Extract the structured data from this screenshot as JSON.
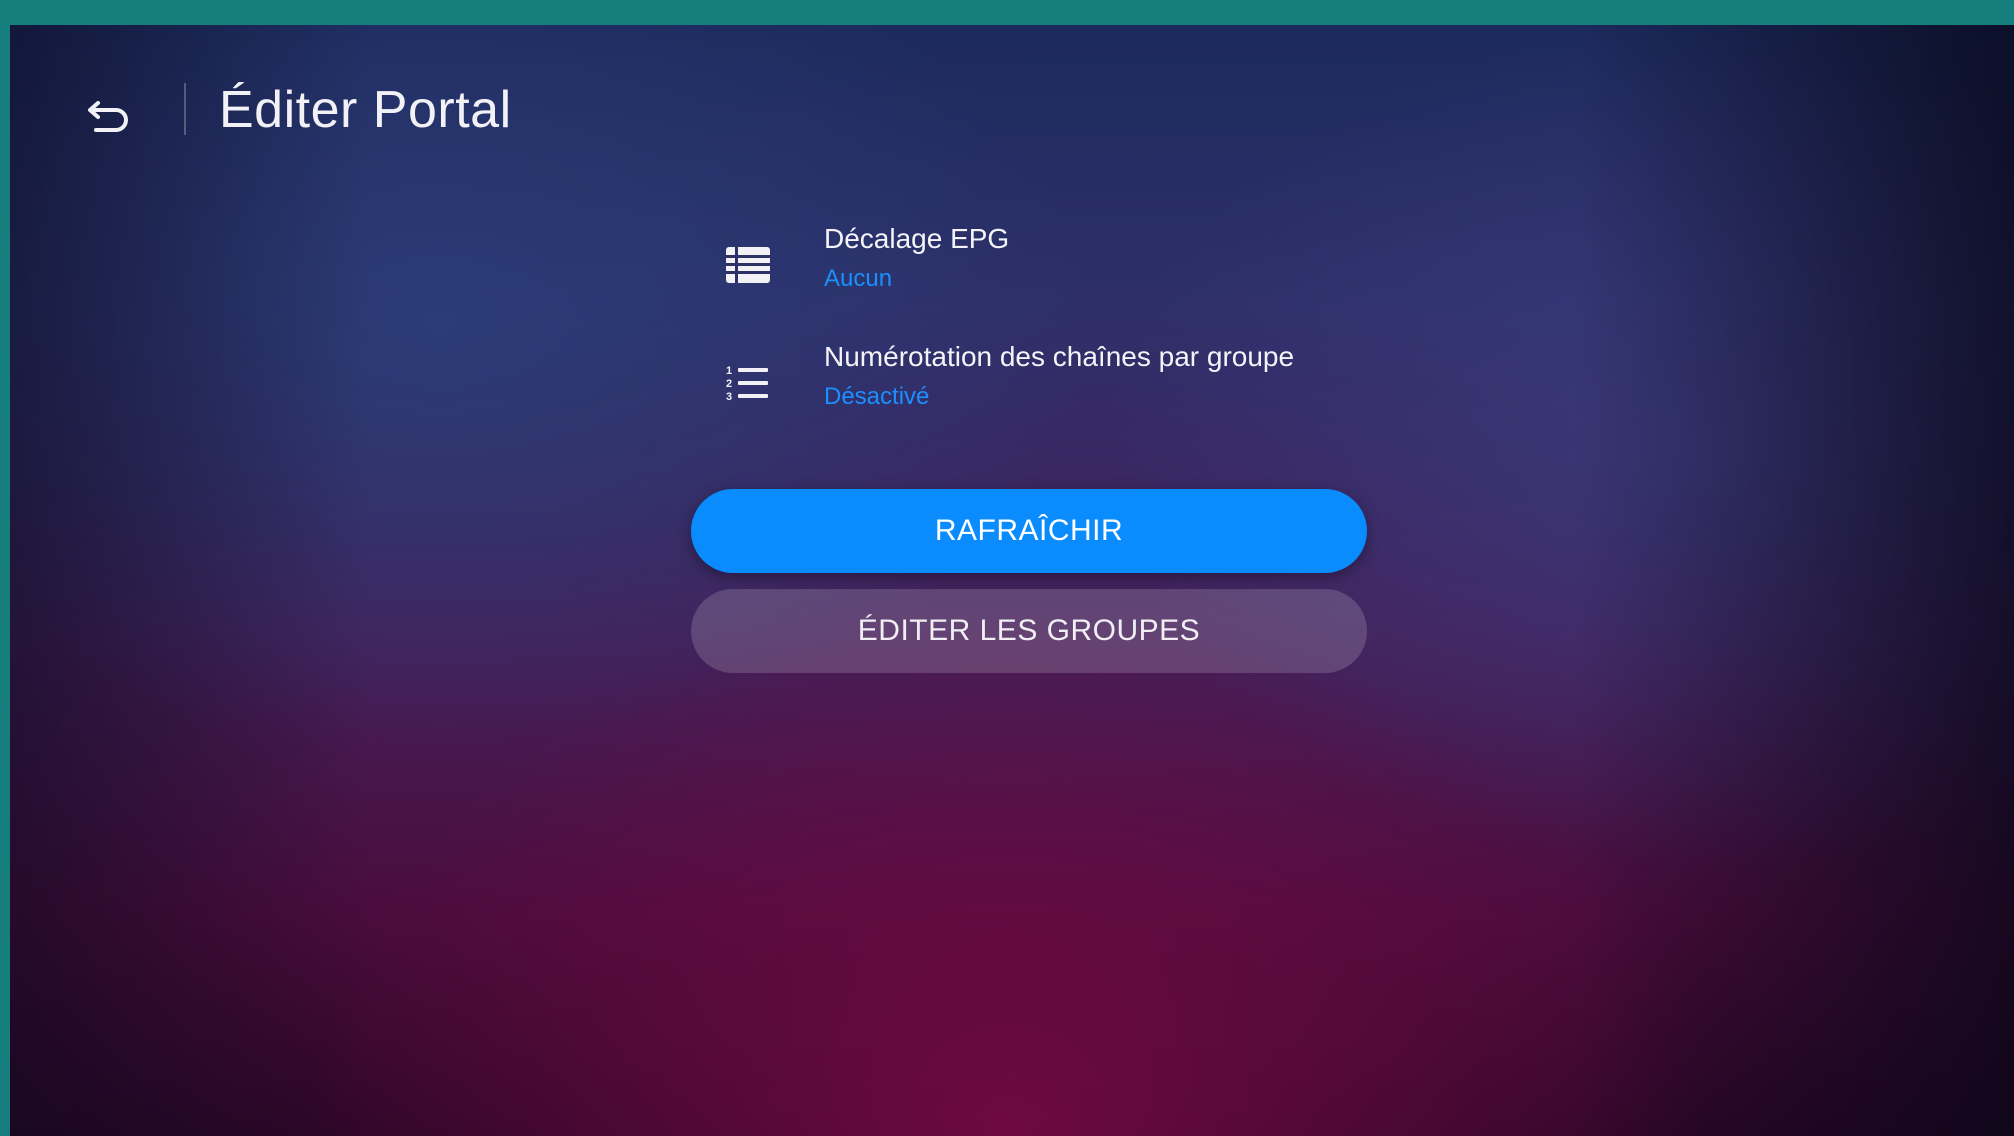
{
  "header": {
    "back_icon": "back-arrow-icon",
    "title": "Éditer Portal"
  },
  "settings": [
    {
      "icon": "epg-grid-icon",
      "label": "Décalage EPG",
      "value": "Aucun"
    },
    {
      "icon": "numbered-list-icon",
      "label": "Numérotation des chaînes par groupe",
      "value": "Désactivé"
    }
  ],
  "buttons": {
    "refresh_label": "RAFRAÎCHIR",
    "edit_groups_label": "ÉDITER LES GROUPES"
  },
  "colors": {
    "accent": "#0a8cff",
    "value_text": "#1a90ff",
    "frame": "#167f7e"
  }
}
